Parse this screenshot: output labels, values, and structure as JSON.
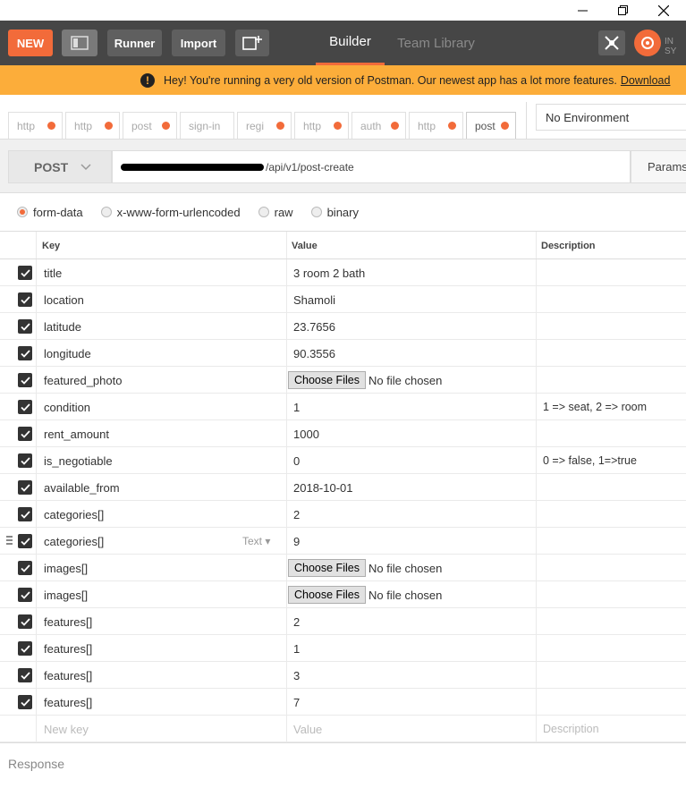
{
  "window": {
    "controls": [
      "minimize",
      "restore",
      "close"
    ]
  },
  "toolbar": {
    "new_label": "NEW",
    "runner_label": "Runner",
    "import_label": "Import",
    "tabs": [
      {
        "label": "Builder",
        "active": true
      },
      {
        "label": "Team Library",
        "active": false
      }
    ],
    "sync_label": "IN SY",
    "accent": "#f26b3a"
  },
  "banner": {
    "message": "Hey! You're running a very old version of Postman. Our newest app has a lot more features.",
    "link": "Download",
    "color": "#fcad3a"
  },
  "request_tabs": [
    {
      "label": "http",
      "dirty": true
    },
    {
      "label": "http",
      "dirty": true
    },
    {
      "label": "post",
      "dirty": true
    },
    {
      "label": "sign-in",
      "dirty": false
    },
    {
      "label": "regi",
      "dirty": true
    },
    {
      "label": "http",
      "dirty": true
    },
    {
      "label": "auth",
      "dirty": true
    },
    {
      "label": "http",
      "dirty": true
    },
    {
      "label": "post",
      "dirty": true
    }
  ],
  "environment": {
    "selected": "No Environment"
  },
  "request": {
    "method": "POST",
    "url_visible": "/api/v1/post-create",
    "params_label": "Params"
  },
  "body_types": [
    {
      "label": "form-data",
      "selected": true
    },
    {
      "label": "x-www-form-urlencoded",
      "selected": false
    },
    {
      "label": "raw",
      "selected": false
    },
    {
      "label": "binary",
      "selected": false
    }
  ],
  "table": {
    "headers": {
      "key": "Key",
      "value": "Value",
      "description": "Description"
    },
    "file_button_label": "Choose Files",
    "file_status": "No file chosen",
    "type_select_label": "Text",
    "rows": [
      {
        "key": "title",
        "value": "3 room 2 bath",
        "description": "",
        "file": false
      },
      {
        "key": "location",
        "value": "Shamoli",
        "description": "",
        "file": false
      },
      {
        "key": "latitude",
        "value": "23.7656",
        "description": "",
        "file": false
      },
      {
        "key": "longitude",
        "value": "90.3556",
        "description": "",
        "file": false
      },
      {
        "key": "featured_photo",
        "value": "",
        "description": "",
        "file": true
      },
      {
        "key": "condition",
        "value": "1",
        "description": "1 => seat, 2 => room",
        "file": false
      },
      {
        "key": "rent_amount",
        "value": "1000",
        "description": "",
        "file": false
      },
      {
        "key": "is_negotiable",
        "value": "0",
        "description": "0 => false, 1=>true",
        "file": false
      },
      {
        "key": "available_from",
        "value": "2018-10-01",
        "description": "",
        "file": false
      },
      {
        "key": "categories[]",
        "value": "2",
        "description": "",
        "file": false
      },
      {
        "key": "categories[]",
        "value": "9",
        "description": "",
        "file": false,
        "hover": true
      },
      {
        "key": "images[]",
        "value": "",
        "description": "",
        "file": true
      },
      {
        "key": "images[]",
        "value": "",
        "description": "",
        "file": true
      },
      {
        "key": "features[]",
        "value": "2",
        "description": "",
        "file": false
      },
      {
        "key": "features[]",
        "value": "1",
        "description": "",
        "file": false
      },
      {
        "key": "features[]",
        "value": "3",
        "description": "",
        "file": false
      },
      {
        "key": "features[]",
        "value": "7",
        "description": "",
        "file": false
      }
    ],
    "new_row": {
      "key_placeholder": "New key",
      "value_placeholder": "Value",
      "description_placeholder": "Description"
    }
  },
  "response": {
    "label": "Response"
  }
}
